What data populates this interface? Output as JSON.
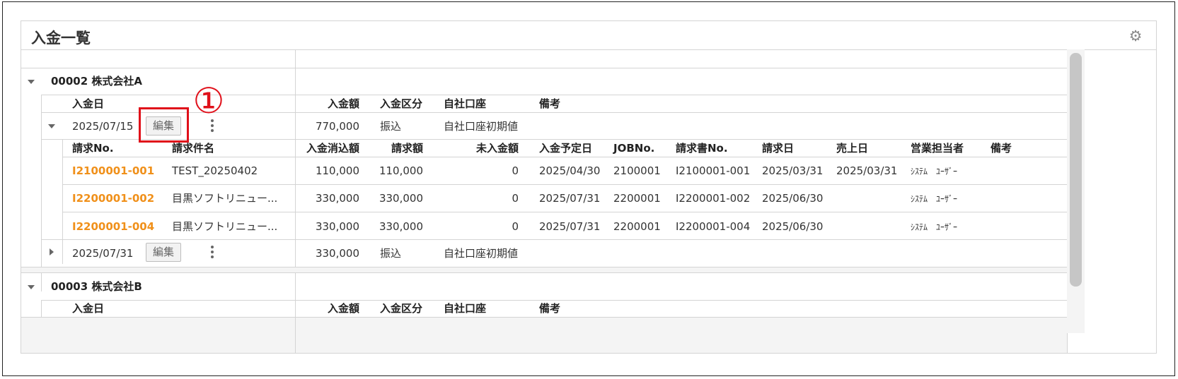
{
  "panel": {
    "title": "入金一覧"
  },
  "groups": [
    {
      "header": "00002 株式会社A",
      "columns": {
        "date": "入金日",
        "amount": "入金額",
        "type": "入金区分",
        "account": "自社口座",
        "note": "備考"
      },
      "payments": [
        {
          "date": "2025/07/15",
          "edit_label": "編集",
          "amount": "770,000",
          "type": "振込",
          "account": "自社口座初期値",
          "detail_columns": [
            "請求No.",
            "請求件名",
            "入金消込額",
            "請求額",
            "未入金額",
            "入金予定日",
            "JOBNo.",
            "請求書No.",
            "請求日",
            "売上日",
            "営業担当者",
            "備考"
          ],
          "details": [
            {
              "no": "I2100001-001",
              "name": "TEST_20250402",
              "cleared": "110,000",
              "billed": "110,000",
              "unpaid": "0",
              "planned": "2025/04/30",
              "job": "2100001",
              "invoice": "I2100001-001",
              "bill_date": "2025/03/31",
              "sales_date": "2025/03/31",
              "staff": "ｼｽﾃﾑ　ﾕｰｻﾞｰ"
            },
            {
              "no": "I2200001-002",
              "name": "目黒ソフトリニュー...",
              "cleared": "330,000",
              "billed": "330,000",
              "unpaid": "0",
              "planned": "2025/07/31",
              "job": "2200001",
              "invoice": "I2200001-002",
              "bill_date": "2025/06/30",
              "sales_date": "",
              "staff": "ｼｽﾃﾑ　ﾕｰｻﾞｰ"
            },
            {
              "no": "I2200001-004",
              "name": "目黒ソフトリニュー...",
              "cleared": "330,000",
              "billed": "330,000",
              "unpaid": "0",
              "planned": "2025/07/31",
              "job": "2200001",
              "invoice": "I2200001-004",
              "bill_date": "2025/06/30",
              "sales_date": "",
              "staff": "ｼｽﾃﾑ　ﾕｰｻﾞｰ"
            }
          ]
        },
        {
          "date": "2025/07/31",
          "edit_label": "編集",
          "amount": "330,000",
          "type": "振込",
          "account": "自社口座初期値"
        }
      ]
    },
    {
      "header": "00003 株式会社B",
      "columns": {
        "date": "入金日",
        "amount": "入金額",
        "type": "入金区分",
        "account": "自社口座",
        "note": "備考"
      }
    }
  ],
  "annotation": {
    "label": "①",
    "color": "#e0101a"
  },
  "colors": {
    "link": "#f0901a",
    "border": "#d4d4d4",
    "header_bg": "#f4f4f4"
  },
  "icons": {
    "settings": "gear-icon",
    "expanded": "caret-down-icon",
    "collapsed": "caret-right-icon",
    "more": "kebab-menu-icon"
  }
}
